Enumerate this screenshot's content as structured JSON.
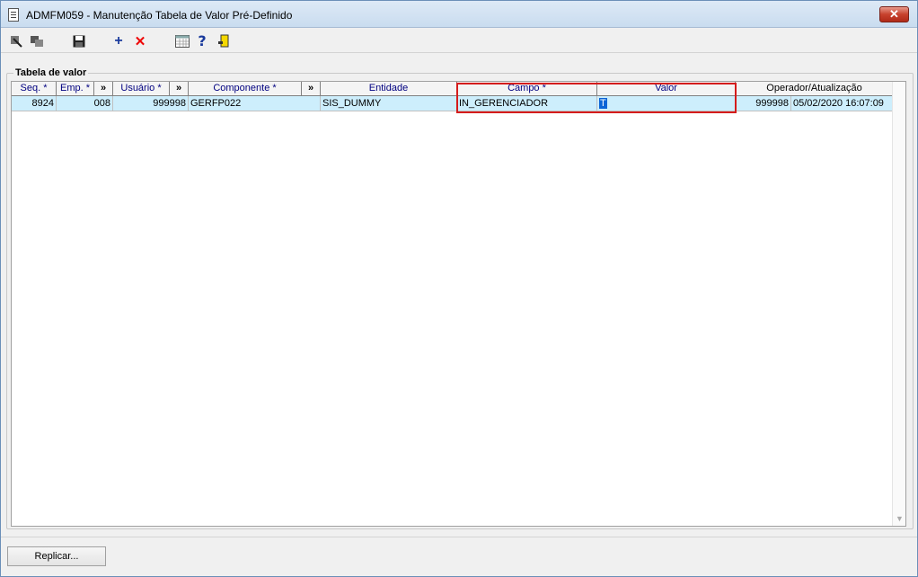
{
  "window": {
    "title": "ADMFM059 - Manutenção Tabela de Valor Pré-Definido",
    "close_label": "✕"
  },
  "toolbar": {
    "add_label": "+",
    "delete_label": "✕",
    "help_label": "?"
  },
  "group": {
    "title": "Tabela de valor"
  },
  "table": {
    "headers": {
      "seq": "Seq. *",
      "emp": "Emp. *",
      "more1": "»",
      "usuario": "Usuário *",
      "more2": "»",
      "componente": "Componente *",
      "more3": "»",
      "entidade": "Entidade",
      "campo": "Campo *",
      "valor": "Valor",
      "operador": "Operador/Atualização"
    },
    "rows": [
      {
        "seq": "8924",
        "emp": "008",
        "usuario": "999998",
        "componente": "GERFP022",
        "entidade": "SIS_DUMMY",
        "campo": "IN_GERENCIADOR",
        "valor": "T",
        "operador": "999998",
        "atualizacao": "05/02/2020 16:07:09"
      }
    ]
  },
  "footer": {
    "replicar_label": "Replicar..."
  },
  "colors": {
    "highlight": "#d41c1c",
    "row_bg": "#cdeefc",
    "header_text": "#000080"
  }
}
